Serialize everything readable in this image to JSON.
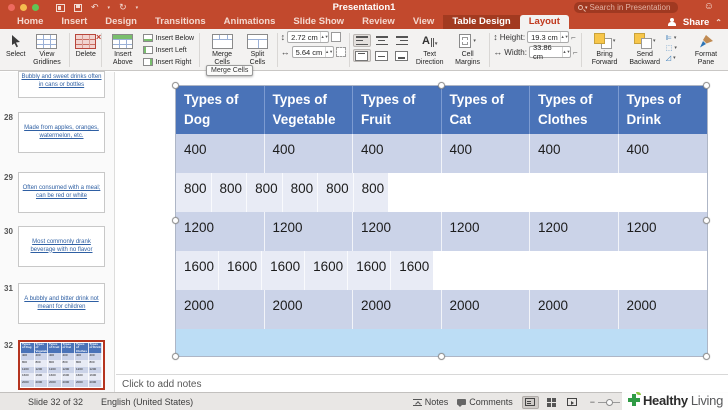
{
  "titlebar": {
    "title": "Presentation1",
    "search_placeholder": "Search in Presentation"
  },
  "tabs": [
    {
      "label": "Home"
    },
    {
      "label": "Insert"
    },
    {
      "label": "Design"
    },
    {
      "label": "Transitions"
    },
    {
      "label": "Animations"
    },
    {
      "label": "Slide Show"
    },
    {
      "label": "Review"
    },
    {
      "label": "View"
    },
    {
      "label": "Table Design",
      "contextual": true
    },
    {
      "label": "Layout",
      "active": true
    }
  ],
  "share": {
    "label": "Share"
  },
  "ribbon": {
    "select": "Select",
    "view_gridlines": "View Gridlines",
    "delete": "Delete",
    "insert_above": "Insert Above",
    "insert_below": "Insert Below",
    "insert_left": "Insert Left",
    "insert_right": "Insert Right",
    "merge_cells": "Merge Cells",
    "split_cells": "Split Cells",
    "merge_tooltip": "Merge Cells",
    "row_height_value": "2.72 cm",
    "col_width_value": "5.64 cm",
    "text_direction": "Text Direction",
    "cell_margins": "Cell Margins",
    "height_label": "Height:",
    "height_value": "19.3 cm",
    "width_label": "Width:",
    "width_value": "33.86 cm",
    "bring_forward": "Bring Forward",
    "send_backward": "Send Backward",
    "format_pane": "Format Pane"
  },
  "sidebar": {
    "slides": [
      {
        "num": "",
        "text": "Bubbly and sweet drinks often in cans or bottles",
        "partial": true
      },
      {
        "num": "28",
        "text": "Made from apples, oranges, watermelon, etc."
      },
      {
        "num": "29",
        "text": "Often consumed with a meal; can be red or white"
      },
      {
        "num": "30",
        "text": "Most commonly drank beverage with no flavor"
      },
      {
        "num": "31",
        "text": "A bubbly and bitter drink not meant for children"
      },
      {
        "num": "32",
        "text": "",
        "selected": true,
        "is_table": true
      }
    ]
  },
  "table": {
    "headers": [
      "Types of Dog",
      "Types of Vegetable",
      "Types of Fruit",
      "Types of Cat",
      "Types of Clothes",
      "Types of Drink"
    ],
    "rows": [
      [
        "400",
        "400",
        "400",
        "400",
        "400",
        "400"
      ],
      [
        "800",
        "800",
        "800",
        "800",
        "800",
        "800"
      ],
      [
        "1200",
        "1200",
        "1200",
        "1200",
        "1200",
        "1200"
      ],
      [
        "1600",
        "1600",
        "1600",
        "1600",
        "1600",
        "1600"
      ],
      [
        "2000",
        "2000",
        "2000",
        "2000",
        "2000",
        "2000"
      ]
    ]
  },
  "notes_placeholder": "Click to add notes",
  "statusbar": {
    "slide_info": "Slide 32 of 32",
    "language": "English (United States)",
    "notes": "Notes",
    "comments": "Comments"
  },
  "watermark": {
    "bold": "Healthy",
    "light": "Living"
  },
  "icons": {
    "undo": "↶",
    "redo": "↻",
    "caret_down": "▾",
    "smiley": "☺",
    "chevron_up": "⌃",
    "stepper_up": "▲",
    "stepper_down": "▼",
    "v_arrows": "↕",
    "h_arrows": "↔"
  },
  "colors": {
    "titlebar_red": "#C2492D",
    "contextual_tab_red": "#A23A20",
    "table_header_blue": "#4A73B8",
    "row_band_dark": "#CBD3E8",
    "row_band_light": "#E8EBF5",
    "selected_row_blue": "#BCDDF5",
    "thumb_link_blue": "#2E5FA3",
    "thumb_selected_border": "#B5341F",
    "logo_green": "#2F9B45"
  }
}
